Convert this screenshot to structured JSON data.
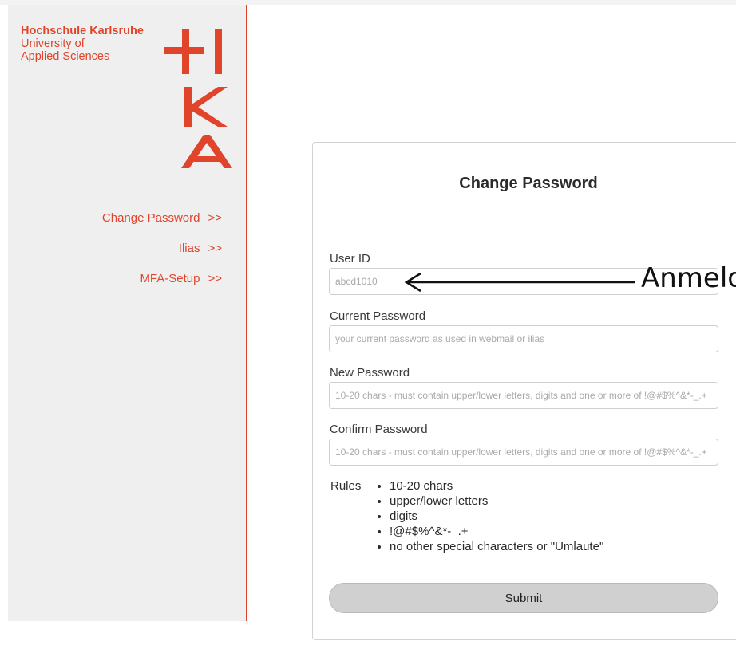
{
  "brand": {
    "line1": "Hochschule Karlsruhe",
    "line2": "University of",
    "line3": "Applied Sciences",
    "logo_icon": "hka-logo-icon",
    "color": "#e0442a"
  },
  "nav": {
    "items": [
      {
        "label": "Change Password",
        "arrow": ">>"
      },
      {
        "label": "Ilias",
        "arrow": ">>"
      },
      {
        "label": "MFA-Setup",
        "arrow": ">>"
      }
    ]
  },
  "form": {
    "title": "Change Password",
    "user_id": {
      "label": "User ID",
      "placeholder": "abcd1010",
      "value": ""
    },
    "current_password": {
      "label": "Current Password",
      "placeholder": "your current password as used in webmail or ilias",
      "value": ""
    },
    "new_password": {
      "label": "New Password",
      "placeholder": "10-20 chars - must contain upper/lower letters, digits and one or more of !@#$%^&*-_.+",
      "value": ""
    },
    "confirm_password": {
      "label": "Confirm Password",
      "placeholder": "10-20 chars - must contain upper/lower letters, digits and one or more of !@#$%^&*-_.+",
      "value": ""
    },
    "rules_label": "Rules",
    "rules": [
      "10-20 chars",
      "upper/lower letters",
      "digits",
      "!@#$%^&*-_.+",
      "no other special characters or \"Umlaute\""
    ],
    "submit_label": "Submit"
  },
  "annotation": {
    "text": "Anmeldename",
    "arrow_icon": "left-arrow-icon"
  }
}
